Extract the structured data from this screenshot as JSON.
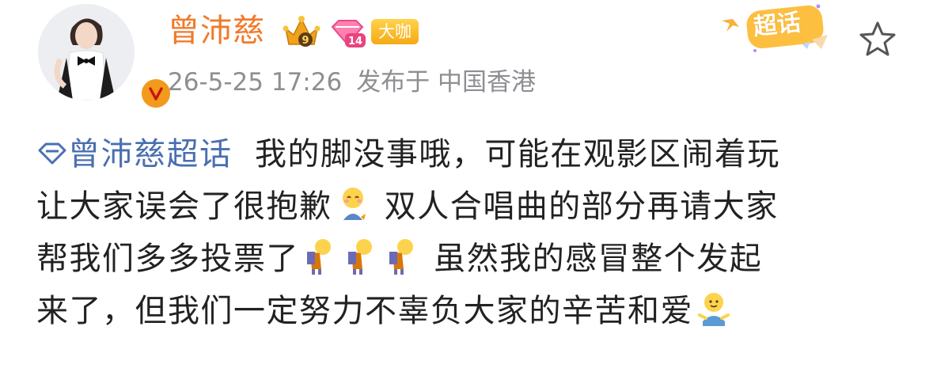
{
  "author": {
    "name": "曾沛慈",
    "crown_level": "9",
    "diamond_level": "14",
    "badge_label": "大咖"
  },
  "meta": {
    "date_time": "26-5-25 17:26",
    "location_label": "发布于 中国香港"
  },
  "header_actions": {
    "chaohua_label": "超话"
  },
  "post": {
    "topic": "曾沛慈超话",
    "segments": [
      "我的脚没事哦，可能在观影区闹着玩",
      "让大家误会了很抱歉",
      "双人合唱曲的部分再请大家",
      "帮我们多多投票了",
      "虽然我的感冒整个发起",
      "来了，但我们一定努力不辜负大家的辛苦和爱"
    ]
  },
  "icons": {
    "avatar": "avatar",
    "verified": "verified-v-icon",
    "crown": "crown-icon",
    "diamond": "diamond-level-icon",
    "topic": "diamond-topic-icon",
    "star": "star-icon",
    "emoji_1": "shy-emoji",
    "emoji_2": "bow-emoji",
    "emoji_3": "hug-emoji"
  },
  "colors": {
    "username": "#f07a2c",
    "topic_link": "#4a6fb0",
    "meta_text": "#8e8e93",
    "badge_bg": "#f6a913"
  }
}
